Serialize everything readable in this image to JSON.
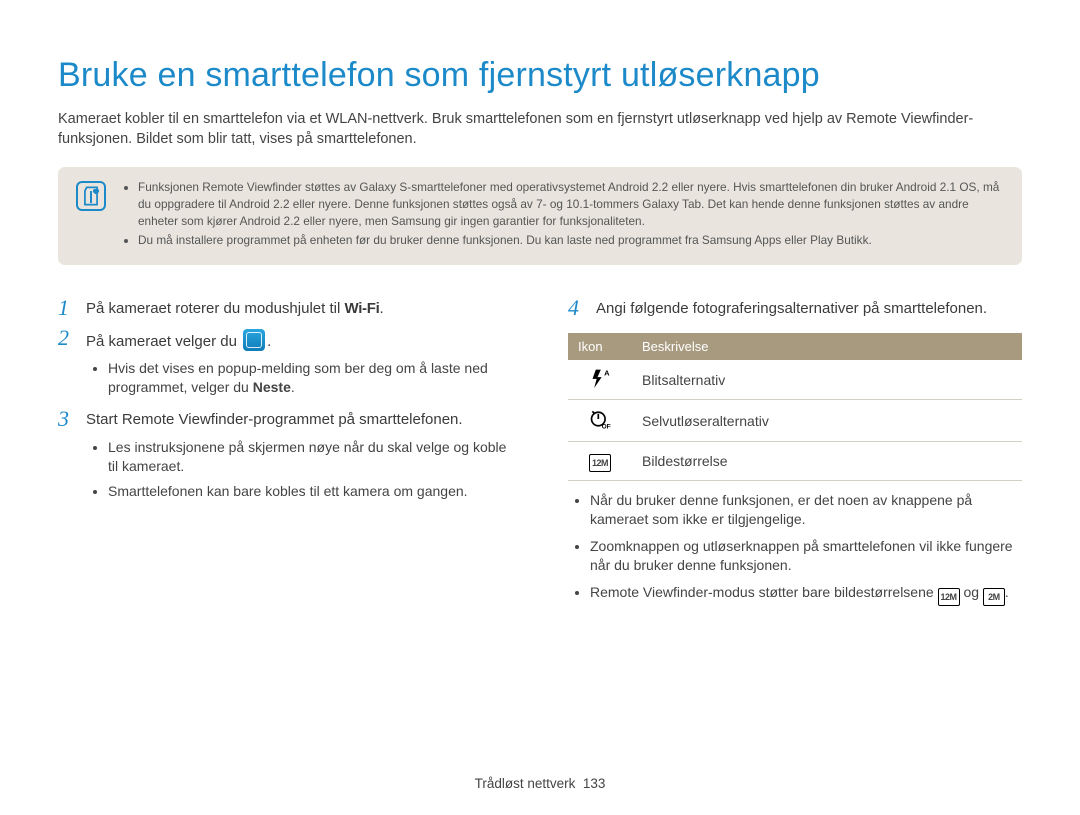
{
  "title": "Bruke en smarttelefon som fjernstyrt utløserknapp",
  "intro": "Kameraet kobler til en smarttelefon via et WLAN-nettverk. Bruk smarttelefonen som en fjernstyrt utløserknapp ved hjelp av Remote Viewfinder-funksjonen. Bildet som blir tatt, vises på smarttelefonen.",
  "note": {
    "bullets": [
      "Funksjonen Remote Viewfinder støttes av Galaxy S-smarttelefoner med operativsystemet Android 2.2 eller nyere. Hvis smarttelefonen din bruker Android 2.1 OS, må du oppgradere til Android 2.2 eller nyere. Denne funksjonen støttes også av 7- og 10.1-tommers Galaxy Tab. Det kan hende denne funksjonen støttes av andre enheter som kjører Android 2.2 eller nyere, men Samsung gir ingen garantier for funksjonaliteten.",
      "Du må installere programmet på enheten før du bruker denne funksjonen. Du kan laste ned programmet fra Samsung Apps eller Play Butikk."
    ]
  },
  "left": {
    "step1_prefix": "På kameraet roterer du modushjulet til ",
    "step1_wifi": "Wi-Fi",
    "step1_suffix": ".",
    "step2_prefix": "På kameraet velger du ",
    "step2_icon_name": "remote-viewfinder-app-icon",
    "step2_suffix": ".",
    "step2_sub_prefix": "Hvis det vises en popup-melding som ber deg om å laste ned programmet, velger du ",
    "step2_sub_bold": "Neste",
    "step2_sub_suffix": ".",
    "step3": "Start Remote Viewfinder-programmet på smarttelefonen.",
    "step3_sub": [
      "Les instruksjonene på skjermen nøye når du skal velge og koble til kameraet.",
      "Smarttelefonen kan bare kobles til ett kamera om gangen."
    ]
  },
  "right": {
    "step4": "Angi følgende fotograferingsalternativer på smarttelefonen.",
    "table": {
      "head_icon": "Ikon",
      "head_desc": "Beskrivelse",
      "rows": [
        {
          "icon": "flash-auto-icon",
          "desc": "Blitsalternativ"
        },
        {
          "icon": "self-timer-off-icon",
          "desc": "Selvutløseralternativ"
        },
        {
          "icon": "resolution-12m-icon",
          "desc": "Bildestørrelse"
        }
      ]
    },
    "bullets": [
      "Når du bruker denne funksjonen, er det noen av knappene på kameraet som ikke er tilgjengelige.",
      "Zoomknappen og utløserknappen på smarttelefonen vil ikke fungere når du bruker denne funksjonen."
    ],
    "bullet3_prefix": "Remote Viewfinder-modus støtter bare bildestørrelsene ",
    "bullet3_mid": " og ",
    "bullet3_suffix": ".",
    "res_icon1_label": "12M",
    "res_icon2_label": "2M"
  },
  "footer": {
    "section": "Trådløst nettverk",
    "page": "133"
  }
}
